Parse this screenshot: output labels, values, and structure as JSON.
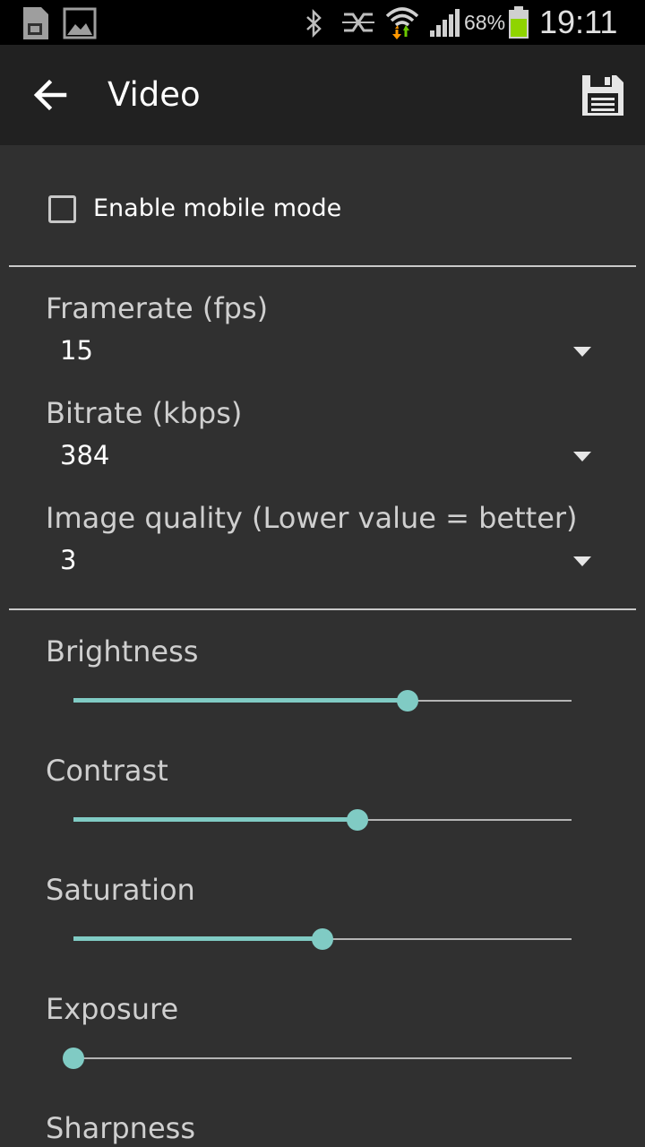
{
  "status_bar": {
    "battery_percent": "68%",
    "time": "19:11",
    "icons": [
      "sim-card-icon",
      "image-icon",
      "bluetooth-icon",
      "nfc-icon",
      "wifi-icon",
      "signal-icon",
      "battery-icon"
    ]
  },
  "app_bar": {
    "title": "Video",
    "back_icon": "arrow-back-icon",
    "save_icon": "floppy-disk-icon"
  },
  "mobile_mode": {
    "label": "Enable mobile mode",
    "checked": false
  },
  "dropdowns": [
    {
      "label": "Framerate (fps)",
      "value": "15"
    },
    {
      "label": "Bitrate (kbps)",
      "value": "384"
    },
    {
      "label": "Image quality (Lower value = better)",
      "value": "3"
    }
  ],
  "sliders": [
    {
      "label": "Brightness",
      "value": 0.67
    },
    {
      "label": "Contrast",
      "value": 0.57
    },
    {
      "label": "Saturation",
      "value": 0.5
    },
    {
      "label": "Exposure",
      "value": 0.0
    },
    {
      "label": "Sharpness",
      "value": null
    }
  ],
  "colors": {
    "accent": "#80cbc4",
    "background": "#303030",
    "app_bar": "#212121",
    "status_bar": "#000000",
    "battery": "#8fd400",
    "data_up": "#6bc900",
    "data_down": "#ff9800"
  }
}
